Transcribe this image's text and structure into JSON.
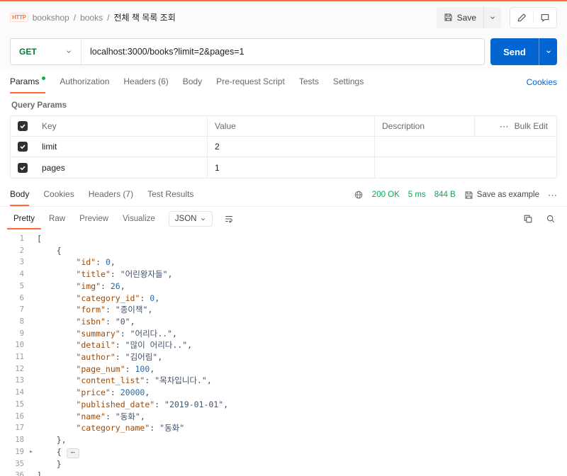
{
  "app": {
    "accent_color": "#ff6c37",
    "send_color": "#0265d2",
    "success_color": "#0ca454"
  },
  "header": {
    "protocol_badge": "HTTP",
    "breadcrumb": [
      "bookshop",
      "books",
      "전체 책 목록 조회"
    ],
    "separator": "/",
    "save_label": "Save"
  },
  "request": {
    "method": "GET",
    "url": "localhost:3000/books?limit=2&pages=1",
    "send_label": "Send"
  },
  "request_tabs": {
    "items": [
      {
        "label": "Params"
      },
      {
        "label": "Authorization"
      },
      {
        "label": "Headers (6)"
      },
      {
        "label": "Body"
      },
      {
        "label": "Pre-request Script"
      },
      {
        "label": "Tests"
      },
      {
        "label": "Settings"
      }
    ],
    "cookies_link": "Cookies"
  },
  "query_params": {
    "title": "Query Params",
    "columns": [
      "Key",
      "Value",
      "Description"
    ],
    "bulk_edit_label": "Bulk Edit",
    "more_glyph": "⋯",
    "rows": [
      {
        "key": "limit",
        "value": "2",
        "description": ""
      },
      {
        "key": "pages",
        "value": "1",
        "description": ""
      }
    ]
  },
  "response": {
    "tabs": [
      {
        "label": "Body"
      },
      {
        "label": "Cookies"
      },
      {
        "label": "Headers (7)"
      },
      {
        "label": "Test Results"
      }
    ],
    "status": "200 OK",
    "time": "5 ms",
    "size": "844 B",
    "save_as_example": "Save as example",
    "more_glyph": "⋯",
    "view_tabs": [
      "Pretty",
      "Raw",
      "Preview",
      "Visualize"
    ],
    "format": "JSON"
  },
  "code": {
    "lines": [
      {
        "n": 1,
        "t": "["
      },
      {
        "n": 2,
        "t": "    {"
      },
      {
        "n": 3,
        "t": "        \"id\": 0,"
      },
      {
        "n": 4,
        "t": "        \"title\": \"어린왕자들\","
      },
      {
        "n": 5,
        "t": "        \"img\": 26,"
      },
      {
        "n": 6,
        "t": "        \"category_id\": 0,"
      },
      {
        "n": 7,
        "t": "        \"form\": \"종이책\","
      },
      {
        "n": 8,
        "t": "        \"isbn\": \"0\","
      },
      {
        "n": 9,
        "t": "        \"summary\": \"어리다..\","
      },
      {
        "n": 10,
        "t": "        \"detail\": \"많이 어리다..\","
      },
      {
        "n": 11,
        "t": "        \"author\": \"김어림\","
      },
      {
        "n": 12,
        "t": "        \"page_num\": 100,"
      },
      {
        "n": 13,
        "t": "        \"content_list\": \"목차입니다.\","
      },
      {
        "n": 14,
        "t": "        \"price\": 20000,"
      },
      {
        "n": 15,
        "t": "        \"published_date\": \"2019-01-01\","
      },
      {
        "n": 16,
        "t": "        \"name\": \"동화\","
      },
      {
        "n": 17,
        "t": "        \"category_name\": \"동화\""
      },
      {
        "n": 18,
        "t": "    },"
      },
      {
        "n": 19,
        "t": "    {",
        "fold": true,
        "ellipsis": true
      },
      {
        "n": 35,
        "t": "    }"
      },
      {
        "n": 36,
        "t": "]"
      }
    ]
  }
}
